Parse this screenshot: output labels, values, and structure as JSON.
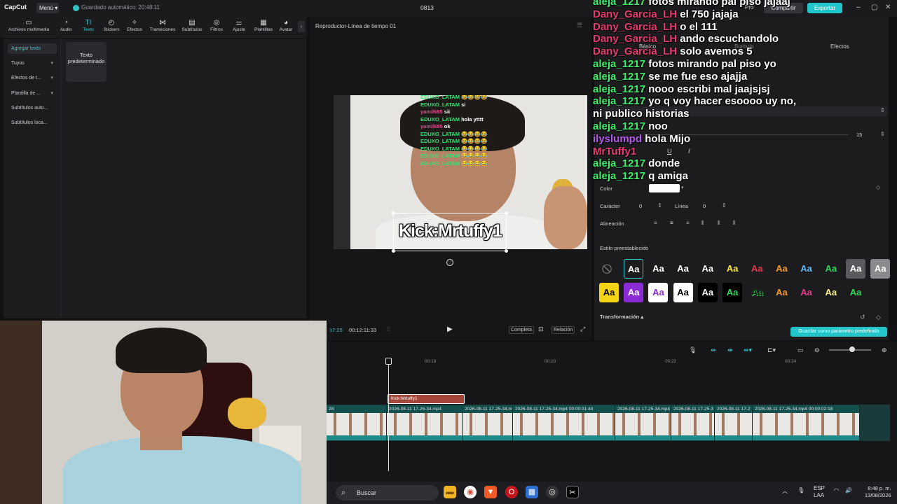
{
  "titlebar": {
    "app_logo": "CapCut",
    "menu_label": "Menú",
    "autosave": "Guardado automático: 20:48:11",
    "project_name": "0813",
    "pro_label": "Pro",
    "share_label": "Compartir",
    "export_label": "Exportar",
    "accent_color": "#22c5c9"
  },
  "toolbar": {
    "items": [
      {
        "label": "Archivos multimedia",
        "icon": "media-icon"
      },
      {
        "label": "Audio",
        "icon": "audio-icon"
      },
      {
        "label": "Texto",
        "icon": "text-icon"
      },
      {
        "label": "Stickers",
        "icon": "sticker-icon"
      },
      {
        "label": "Efectos",
        "icon": "effects-icon"
      },
      {
        "label": "Transiciones",
        "icon": "transitions-icon"
      },
      {
        "label": "Subtítulos",
        "icon": "captions-icon"
      },
      {
        "label": "Filtros",
        "icon": "filters-icon"
      },
      {
        "label": "Ajuste",
        "icon": "adjust-icon"
      },
      {
        "label": "Plantillas",
        "icon": "templates-icon"
      },
      {
        "label": "Avatar",
        "icon": "avatar-icon"
      }
    ],
    "active": "Texto"
  },
  "sidebar": {
    "items": [
      {
        "label": "Agregar texto"
      },
      {
        "label": "Tuyos"
      },
      {
        "label": "Efectos de t..."
      },
      {
        "label": "Plantilla de ..."
      },
      {
        "label": "Subtítulos auto..."
      },
      {
        "label": "Subtítulos loca..."
      }
    ],
    "default_text_card": "Texto predeterminado"
  },
  "player": {
    "title": "Reproductor-Línea de tiempo 01",
    "current_time": "17:25",
    "total_time": "00:12:11:33",
    "full_label": "Completa",
    "ratio_label": "Relación",
    "overlay_text": "Kick:Mrtuffy1",
    "video_chat": [
      {
        "user": "EDUXO_LATAM",
        "msg": "😂😂😂😂"
      },
      {
        "user": "EDUXO_LATAM",
        "msg": "si"
      },
      {
        "user": "yamil685",
        "msg": "sii"
      },
      {
        "user": "EDUXO_LATAM",
        "msg": "hola ytttt"
      },
      {
        "user": "yamil685",
        "msg": "ok"
      },
      {
        "user": "EDUXO_LATAM",
        "msg": "😂😂😂😂"
      },
      {
        "user": "EDUXO_LATAM",
        "msg": "😂😂😂😂"
      },
      {
        "user": "EDUXO_LATAM",
        "msg": "😂😂😂😂"
      },
      {
        "user": "EDUXO_LATAM",
        "msg": "😂😂😂😂"
      },
      {
        "user": "EDUXO_LATAM",
        "msg": "😂😂😂😂"
      }
    ]
  },
  "right_panel": {
    "tabs": [
      "Básico",
      "Burbuja",
      "Efectos"
    ],
    "color_label": "Color",
    "char_label": "Carácter",
    "char_value": "0",
    "line_label": "Línea",
    "line_value": "0",
    "align_label": "Alineación",
    "size_value": "15",
    "preset_label": "Estilo preestablecido",
    "transform_label": "Transformación",
    "save_preset_label": "Guardar como parámetro predefinido",
    "text_color": "#ffffff"
  },
  "presets_row1": [
    {
      "bg": "#1c1c1f",
      "fg": "#777",
      "txt": "⃠",
      "name": "none"
    },
    {
      "bg": "#1c1c1f",
      "fg": "#fff",
      "txt": "Aa",
      "name": "white-outline"
    },
    {
      "bg": "#1c1c1f",
      "fg": "#fff",
      "txt": "Aa",
      "name": "white-shadow"
    },
    {
      "bg": "#1c1c1f",
      "fg": "#fff",
      "txt": "Aa",
      "name": "white-plain"
    },
    {
      "bg": "#1c1c1f",
      "fg": "#fff",
      "txt": "Aa",
      "name": "white-black-stroke"
    },
    {
      "bg": "#1c1c1f",
      "fg": "#f2e640",
      "txt": "Aa",
      "name": "yellow"
    },
    {
      "bg": "#1c1c1f",
      "fg": "#e8344b",
      "txt": "Aa",
      "name": "red"
    },
    {
      "bg": "#1c1c1f",
      "fg": "#f39a2a",
      "txt": "Aa",
      "name": "orange"
    },
    {
      "bg": "#1c1c1f",
      "fg": "#5fb8f0",
      "txt": "Aa",
      "name": "blue"
    },
    {
      "bg": "#1c1c1f",
      "fg": "#2fd65a",
      "txt": "Aa",
      "name": "green"
    },
    {
      "bg": "#5a5a5e",
      "fg": "#fff",
      "txt": "Aa",
      "name": "gray-box"
    },
    {
      "bg": "#8a8a8e",
      "fg": "#fff",
      "txt": "Aa",
      "name": "light-gray-box"
    }
  ],
  "presets_row2": [
    {
      "bg": "#f5d315",
      "fg": "#000",
      "txt": "Aa",
      "name": "yellow-box"
    },
    {
      "bg": "#8b2bd6",
      "fg": "#fff",
      "txt": "Aa",
      "name": "purple-box"
    },
    {
      "bg": "#ffffff",
      "fg": "#8b2bd6",
      "txt": "Aa",
      "name": "white-purple"
    },
    {
      "bg": "#ffffff",
      "fg": "#000",
      "txt": "Aa",
      "name": "white-box"
    },
    {
      "bg": "#000000",
      "fg": "#fff",
      "txt": "Aa",
      "name": "black-box"
    },
    {
      "bg": "#000000",
      "fg": "#2fd65a",
      "txt": "Aa",
      "name": "black-green"
    },
    {
      "bg": "#1c1c1f",
      "fg": "#111",
      "txt": "Aa",
      "name": "dark-green-stroke"
    },
    {
      "bg": "#1c1c1f",
      "fg": "#f39a2a",
      "txt": "Aa",
      "name": "orange-2"
    },
    {
      "bg": "#1c1c1f",
      "fg": "#e83a8a",
      "txt": "Aa",
      "name": "pink"
    },
    {
      "bg": "#1c1c1f",
      "fg": "#f7f08a",
      "txt": "Aa",
      "name": "glow-yellow"
    },
    {
      "bg": "#1c1c1f",
      "fg": "#2fd65a",
      "txt": "Aa",
      "name": "green-2"
    }
  ],
  "overlay_chat": [
    {
      "user": "aleja_1217",
      "msg": "fotos mirando pal piso jajaaj",
      "ucolor": "green"
    },
    {
      "user": "Dany_Garcia_LH",
      "msg": "el 750 jajaja",
      "ucolor": "pink"
    },
    {
      "user": "Dany_Garcia_LH",
      "msg": "o el 111",
      "ucolor": "pink"
    },
    {
      "user": "Dany_Garcia_LH",
      "msg": "ando escuchandolo",
      "ucolor": "pink"
    },
    {
      "user": "Dany_Garcia_LH",
      "msg": "solo avemos 5",
      "ucolor": "pink"
    },
    {
      "user": "aleja_1217",
      "msg": "fotos mirando pal piso yo",
      "ucolor": "green"
    },
    {
      "user": "aleja_1217",
      "msg": "se me fue eso ajajja",
      "ucolor": "green"
    },
    {
      "user": "aleja_1217",
      "msg": "nooo escribi mal jaajsjsj",
      "ucolor": "green"
    },
    {
      "user": "aleja_1217",
      "msg": "yo q voy hacer esoooo uy no,",
      "ucolor": "green"
    },
    {
      "user": "",
      "msg": "ni publico historias",
      "ucolor": "green"
    },
    {
      "user": "aleja_1217",
      "msg": "noo",
      "ucolor": "green"
    },
    {
      "user": "ilyslumpd",
      "msg": "hola Mijo",
      "ucolor": "purple"
    },
    {
      "user": "MrTuffy1",
      "msg": "",
      "ucolor": "pink"
    },
    {
      "user": "aleja_1217",
      "msg": "donde",
      "ucolor": "green"
    },
    {
      "user": "aleja_1217",
      "msg": "q amiga",
      "ucolor": "green"
    }
  ],
  "timeline": {
    "ruler": [
      "00:18",
      "00:20",
      "00:22",
      "00:24"
    ],
    "text_clip": "Kick:Mrtuffy1",
    "clips": [
      {
        "label": "28"
      },
      {
        "label": "2026-08-11 17-25-34.mp4"
      },
      {
        "label": "2026-08-11 17-25-34.m"
      },
      {
        "label": "2026-08-11 17-25-34.mp4   00:00:01:44"
      },
      {
        "label": "2026-08-11 17-25-34.mp4   00:00"
      },
      {
        "label": "2026-08-11 17-25-3"
      },
      {
        "label": "2026-08-11 17-2"
      },
      {
        "label": "2026-08-11 17-25-34.mp4   00:00:02:18"
      }
    ]
  },
  "taskbar": {
    "search": "Buscar",
    "lang": "ESP",
    "lang_sub": "LAA",
    "time": "8:48 p. m.",
    "date": "13/08/2026"
  }
}
